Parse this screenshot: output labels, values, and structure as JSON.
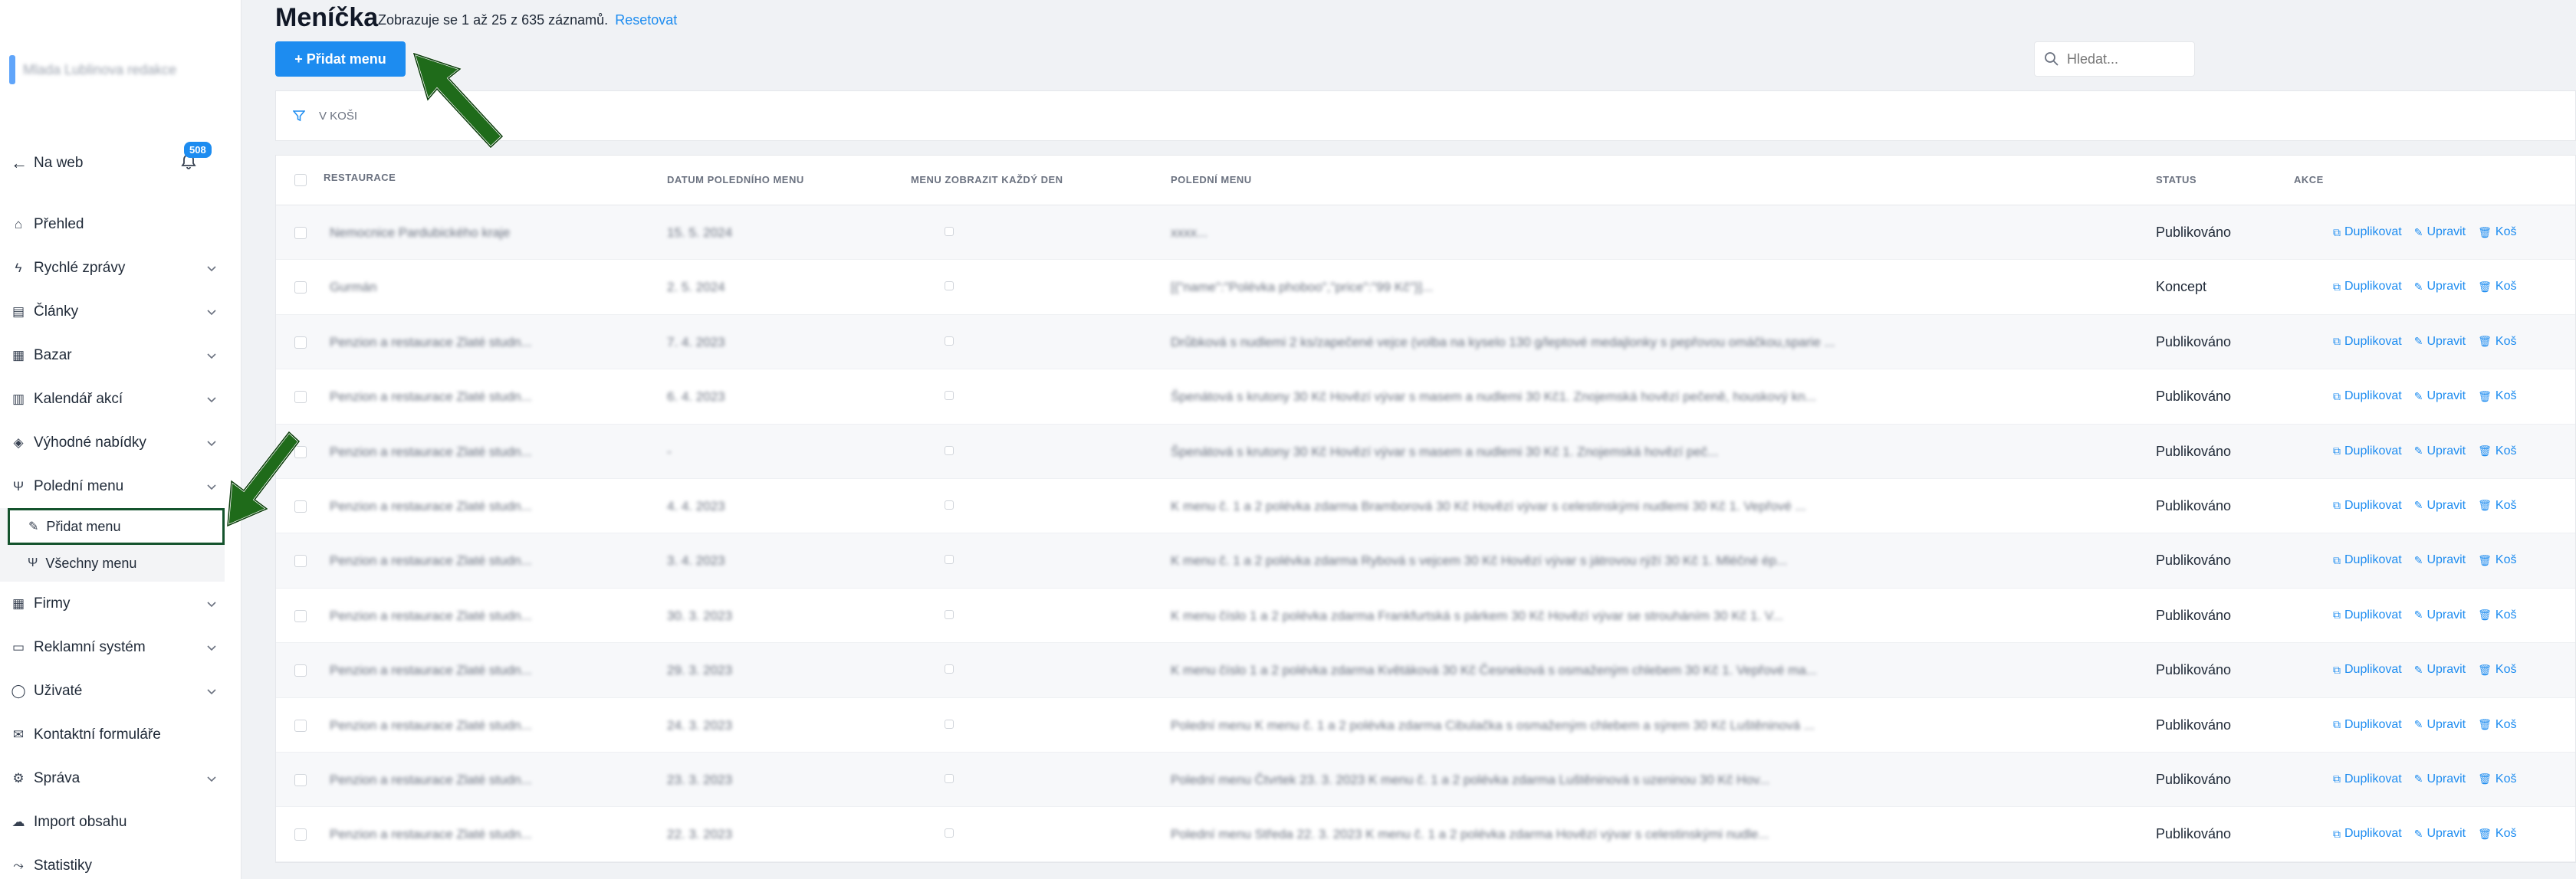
{
  "sidebar": {
    "brand": "Mlada Lublinova redakce",
    "back_label": "Na web",
    "badge": "508",
    "items": [
      {
        "label": "Přehled",
        "icon": "home-icon",
        "chev": false
      },
      {
        "label": "Rychlé zprávy",
        "icon": "bolt-icon",
        "chev": true
      },
      {
        "label": "Články",
        "icon": "newspaper-icon",
        "chev": true
      },
      {
        "label": "Bazar",
        "icon": "store-icon",
        "chev": true
      },
      {
        "label": "Kalendář akcí",
        "icon": "calendar-icon",
        "chev": true
      },
      {
        "label": "Výhodné nabídky",
        "icon": "tag-icon",
        "chev": true
      },
      {
        "label": "Polední menu",
        "icon": "fork-knife-icon",
        "chev": true
      }
    ],
    "sub": [
      {
        "label": "Přidat menu",
        "icon": "edit-icon"
      },
      {
        "label": "Všechny menu",
        "icon": "fork-knife-icon"
      }
    ],
    "items2": [
      {
        "label": "Firmy",
        "icon": "building-icon",
        "chev": true
      },
      {
        "label": "Reklamní systém",
        "icon": "ad-icon",
        "chev": true
      },
      {
        "label": "Uživaté",
        "icon": "user-icon",
        "chev": true
      },
      {
        "label": "Kontaktní formuláře",
        "icon": "mail-icon",
        "chev": false
      },
      {
        "label": "Správa",
        "icon": "gear-icon",
        "chev": true
      },
      {
        "label": "Import obsahu",
        "icon": "cloud-icon",
        "chev": false
      },
      {
        "label": "Statistiky",
        "icon": "chart-icon",
        "chev": false
      }
    ]
  },
  "main": {
    "title": "Meníčka",
    "subtitle": "Zobrazuje se 1 až 25 z 635 záznamů.",
    "reset": "Resetovat",
    "add_button": "+ Přidat menu",
    "search_placeholder": "Hledat...",
    "filter_label": "V KOŠI",
    "columns": [
      "RESTAURACE",
      "DATUM POLEDNÍHO MENU",
      "MENU ZOBRAZIT KAŽDÝ DEN",
      "POLEDNÍ MENU",
      "STATUS",
      "AKCE"
    ],
    "action_labels": {
      "duplicate": "Duplikovat",
      "edit": "Upravit",
      "trash": "Koš"
    },
    "rows": [
      {
        "restaurant": "Nemocnice Pardubického kraje",
        "date": "15. 5. 2024",
        "menu": "xxxx...",
        "status": "Publikováno"
      },
      {
        "restaurant": "Gurmán",
        "date": "2. 5. 2024",
        "menu": "[{\"name\":\"Polévka phoboo\",\"price\":\"99 Kč\"}]...",
        "status": "Koncept"
      },
      {
        "restaurant": "Penzion a restaurace Zlaté studn...",
        "date": "7. 4. 2023",
        "menu": "Drůbková s nudlemi 2 ks/zapečené vejce (volba na kyselo 130 g/leptové medajlonky s pepřovou omáčkou,sparie ...",
        "status": "Publikováno"
      },
      {
        "restaurant": "Penzion a restaurace Zlaté studn...",
        "date": "6. 4. 2023",
        "menu": "Špenátová s krutony 30 Kč Hovězí vývar s masem a nudlemi 30 Kč1. Znojemská hovězí pečeně, houskový kn...",
        "status": "Publikováno"
      },
      {
        "restaurant": "Penzion a restaurace Zlaté studn...",
        "date": "-",
        "menu": "Špenátová s krutony 30 Kč Hovězí vývar s masem a nudlemi 30 Kč 1. Znojemská hovězí peč...",
        "status": "Publikováno"
      },
      {
        "restaurant": "Penzion a restaurace Zlaté studn...",
        "date": "4. 4. 2023",
        "menu": "K menu č. 1 a 2 polévka zdarma Bramborová 30 Kč Hovězí vývar s celestinskými nudlemi 30 Kč 1. Vepřové ...",
        "status": "Publikováno"
      },
      {
        "restaurant": "Penzion a restaurace Zlaté studn...",
        "date": "3. 4. 2023",
        "menu": "K menu č. 1 a 2 polévka zdarma Rybová s vejcem 30 Kč Hovězí vývar s játrovou rýží 30 Kč 1. Mléčné ép...",
        "status": "Publikováno"
      },
      {
        "restaurant": "Penzion a restaurace Zlaté studn...",
        "date": "30. 3. 2023",
        "menu": "K menu číslo 1 a 2 polévka zdarma Frankfurtská s párkem 30 Kč Hovězí vývar se strouháním 30 Kč 1. V...",
        "status": "Publikováno"
      },
      {
        "restaurant": "Penzion a restaurace Zlaté studn...",
        "date": "29. 3. 2023",
        "menu": "K menu číslo 1 a 2 polévka zdarma Květáková 30 Kč Česneková s osmaženým chlebem 30 Kč 1. Vepřové ma...",
        "status": "Publikováno"
      },
      {
        "restaurant": "Penzion a restaurace Zlaté studn...",
        "date": "24. 3. 2023",
        "menu": "Polední menu K menu č. 1 a 2 polévka zdarma Cibulačka s osmaženým chlebem a sýrem 30 Kč Luštěninová ...",
        "status": "Publikováno"
      },
      {
        "restaurant": "Penzion a restaurace Zlaté studn...",
        "date": "23. 3. 2023",
        "menu": "Polední menu Čtvrtek 23. 3. 2023 K menu č. 1 a 2 polévka zdarma Luštěninová s uzeninou 30 Kč Hov...",
        "status": "Publikováno"
      },
      {
        "restaurant": "Penzion a restaurace Zlaté studn...",
        "date": "22. 3. 2023",
        "menu": "Polední menu Středa 22. 3. 2023 K menu č. 1 a 2 polévka zdarma Hovězí vývar s celestinskými nudle...",
        "status": "Publikováno"
      }
    ]
  },
  "colors": {
    "accent": "#1d8cf0",
    "arrow": "#1f6b1a"
  }
}
